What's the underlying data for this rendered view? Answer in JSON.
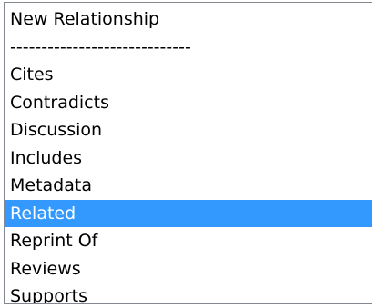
{
  "listbox": {
    "items": [
      {
        "label": "New Relationship"
      },
      {
        "label": "-----------------------------"
      },
      {
        "label": "Cites"
      },
      {
        "label": "Contradicts"
      },
      {
        "label": "Discussion"
      },
      {
        "label": "Includes"
      },
      {
        "label": "Metadata"
      },
      {
        "label": "Related"
      },
      {
        "label": "Reprint Of"
      },
      {
        "label": "Reviews"
      },
      {
        "label": "Supports"
      }
    ],
    "selected_label": "Related",
    "colors": {
      "selection_bg": "#3399ff",
      "selection_text": "#ffffff",
      "border": "#828790"
    }
  }
}
